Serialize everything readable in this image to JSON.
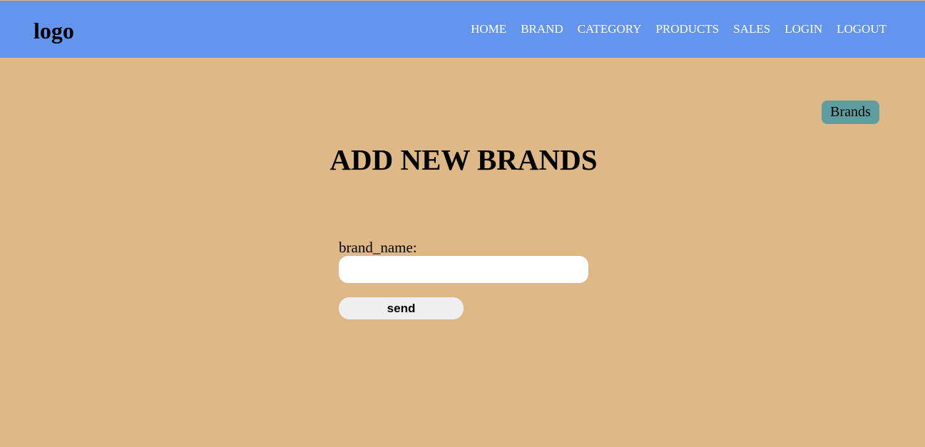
{
  "header": {
    "logo": "logo",
    "nav": [
      {
        "label": "HOME"
      },
      {
        "label": "BRAND"
      },
      {
        "label": "CATEGORY"
      },
      {
        "label": "PRODUCTS"
      },
      {
        "label": "SALES"
      },
      {
        "label": "LOGIN"
      },
      {
        "label": "LOGOUT"
      }
    ]
  },
  "main": {
    "brands_button": "Brands",
    "title": "ADD NEW BRANDS",
    "form": {
      "field_label": "brand_name:",
      "field_value": "",
      "submit_label": "send"
    }
  },
  "colors": {
    "header_bg": "#6495ed",
    "page_bg": "#deb887",
    "brands_button_bg": "#5f9ea0",
    "input_bg": "#ffffff",
    "submit_bg": "#efefef"
  }
}
